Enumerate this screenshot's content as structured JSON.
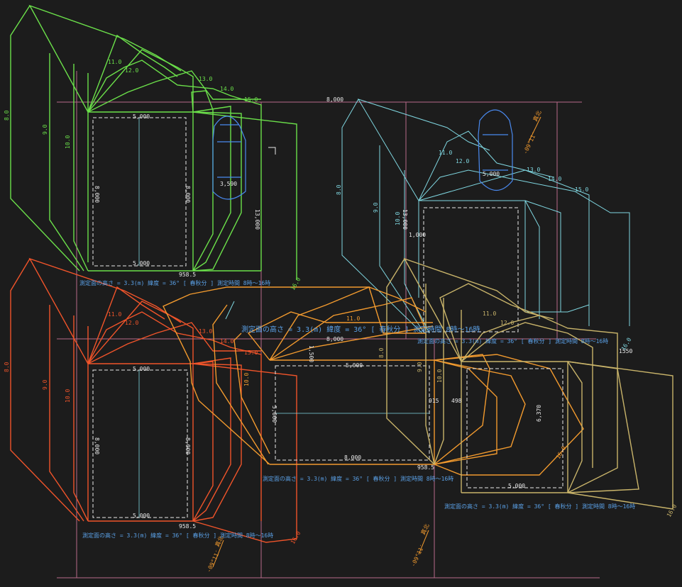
{
  "colors": {
    "background": "#1c1c1c",
    "green": "#6be04a",
    "red": "#f0542a",
    "orange": "#f29a2e",
    "tan": "#c9b46a",
    "cyan": "#7fd6e0",
    "pink": "#b86a8a",
    "blue_car": "#4a8af0",
    "caption": "#5aa0e6"
  },
  "grid_labels": {
    "top_8000": "8,000",
    "mid_8000": "8,000",
    "bottom_8000": "8,000",
    "w5000_a": "5,000",
    "w5000_b": "5,000",
    "w5000_c": "5,000",
    "w5000_d": "5,000",
    "v8000_a": "8,000",
    "v8000_b": "8,000",
    "v8000_c": "8,000",
    "v8000_d": "8,000",
    "v13000_a": "13,000",
    "v13000_b": "13,000",
    "dim_3590": "3,590",
    "dim_1000": "1,000",
    "dim_1500": "1,500",
    "dim_5000v": "5,000",
    "dim_6370": "6,370",
    "dim_915": "915",
    "dim_498": "498",
    "dim_9585_a": "958.5",
    "dim_9585_b": "958.5",
    "dim_9585_c": "958.5",
    "dim_9585_d": "958.5",
    "dim_9585_e": "958.5",
    "dim_1550": "1550"
  },
  "hour_labels": {
    "h8": "8.0",
    "h9": "9.0",
    "h10": "10.0",
    "h11": "11.0",
    "h12": "12.0",
    "h13": "13.0",
    "h14": "14.0",
    "h15": "15.0",
    "h16": "16.0"
  },
  "captions": {
    "green": "測定面の高さ = 3.3(m)  緯度 = 36°  [ 春秋分 ]  測定時間 8時～16時",
    "red": "測定面の高さ = 3.3(m)  緯度 = 36°  [ 春秋分 ]  測定時間 8時～16時",
    "orange": "測定面の高さ = 3.3(m)  緯度 = 36°  [ 春秋分 ]  測定時間 8時～16時",
    "tan": "測定面の高さ = 3.3(m)  緯度 = 36°  [ 春秋分 ]  測定時間 8時～16時",
    "cyan": "測定面の高さ = 3.3(m)  緯度 = 36°  [ 春秋分 ]  測定時間 8時～16時",
    "center_big": "測定面の高さ = 3.3(m)  緯度 = 36°  [ 春秋分 ]  測定時間 8時～16時"
  },
  "north_labels": {
    "a": "真北",
    "b": "真北",
    "c": "真北",
    "deg": "-09°11′"
  }
}
